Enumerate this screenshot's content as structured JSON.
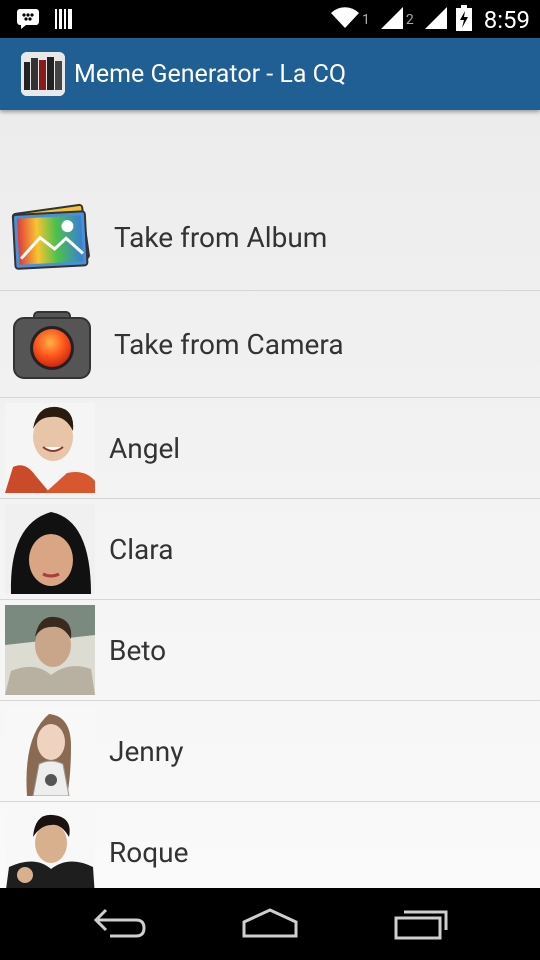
{
  "status_bar": {
    "sim1": "1",
    "sim2": "2",
    "time": "8:59"
  },
  "app_bar": {
    "title": "Meme Generator - La CQ"
  },
  "actions": [
    {
      "label": "Take from Album",
      "icon": "photo-album-icon"
    },
    {
      "label": "Take from Camera",
      "icon": "camera-icon"
    }
  ],
  "people": [
    {
      "name": "Angel"
    },
    {
      "name": "Clara"
    },
    {
      "name": "Beto"
    },
    {
      "name": "Jenny"
    },
    {
      "name": "Roque"
    }
  ],
  "nav": {
    "back": "back-icon",
    "home": "home-icon",
    "recents": "recent-apps-icon"
  }
}
